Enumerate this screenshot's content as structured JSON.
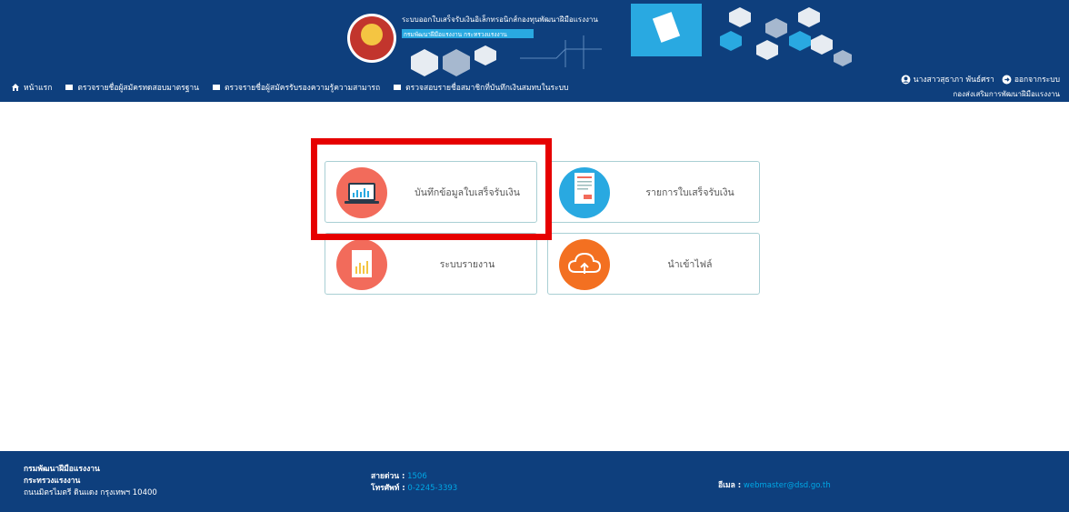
{
  "header": {
    "banner_title": "ระบบออกใบเสร็จรับเงินอิเล็กทรอนิกส์กองทุนพัฒนาฝีมือแรงงาน",
    "banner_subtitle": "กรมพัฒนาฝีมือแรงงาน กระทรวงแรงงาน"
  },
  "nav": {
    "items": [
      {
        "label": "หน้าแรก",
        "icon": "home-icon"
      },
      {
        "label": "ตรวจรายชื่อผู้สมัครทดสอบมาตรฐาน",
        "icon": "list-icon"
      },
      {
        "label": "ตรวจรายชื่อผู้สมัครรับรองความรู้ความสามารถ",
        "icon": "list-icon"
      },
      {
        "label": "ตรวจสอบรายชื่อสมาชิกที่บันทึกเงินสมทบในระบบ",
        "icon": "list-icon"
      }
    ]
  },
  "user": {
    "name": "นางสาวสุธาภา พันธ์ศรา",
    "logout": "ออกจากระบบ",
    "department": "กองส่งเสริมการพัฒนาฝีมือแรงงาน"
  },
  "tiles": [
    {
      "label": "บันทึกข้อมูลใบเสร็จรับเงิน",
      "icon": "laptop-chart-icon",
      "color": "#f26b5b"
    },
    {
      "label": "รายการใบเสร็จรับเงิน",
      "icon": "receipt-icon",
      "color": "#29a9e1"
    },
    {
      "label": "ระบบรายงาน",
      "icon": "report-icon",
      "color": "#f26b5b"
    },
    {
      "label": "นำเข้าไฟล์",
      "icon": "cloud-upload-icon",
      "color": "#f37021"
    }
  ],
  "footer": {
    "org": "กรมพัฒนาฝีมือแรงงาน",
    "ministry": "กระทรวงแรงงาน",
    "address": "ถนนมิตรไมตรี ดินแดง กรุงเทพฯ 10400",
    "hotline_label": "สายด่วน :",
    "hotline_value": "1506",
    "phone_label": "โทรศัพท์ :",
    "phone_value": "0-2245-3393",
    "email_label": "อีเมล :",
    "email_value": "webmaster@dsd.go.th"
  },
  "colors": {
    "header_bg": "#0e3f7d",
    "highlight": "#e60000",
    "tile_border": "#a9cfd4"
  }
}
